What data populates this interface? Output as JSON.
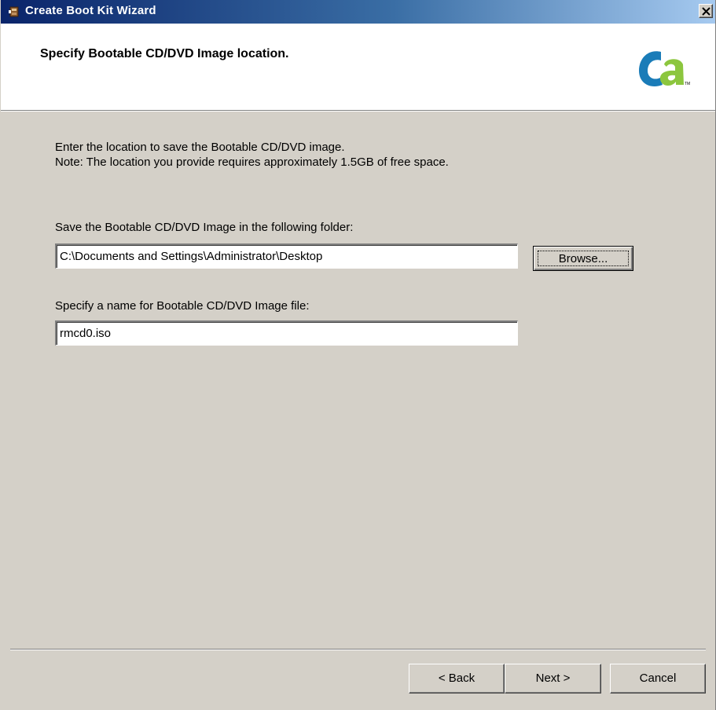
{
  "window": {
    "title": "Create Boot Kit Wizard"
  },
  "header": {
    "title": "Specify Bootable CD/DVD Image location."
  },
  "body": {
    "intro_line1": "Enter the location to save the Bootable CD/DVD image.",
    "intro_line2": "Note: The location you provide requires approximately 1.5GB of free space.",
    "folder_label": "Save the Bootable CD/DVD Image in the following folder:",
    "folder_value": "C:\\Documents and Settings\\Administrator\\Desktop",
    "browse_label": "Browse...",
    "name_label": "Specify a name for Bootable CD/DVD Image file:",
    "name_value": "rmcd0.iso"
  },
  "footer": {
    "back_label": "< Back",
    "next_label": "Next >",
    "cancel_label": "Cancel"
  },
  "colors": {
    "titlebar_start": "#0a246a",
    "titlebar_end": "#a6caf0",
    "dialog_face": "#d4d0c8",
    "logo_blue": "#1a7cb8",
    "logo_green": "#8cc63e"
  }
}
